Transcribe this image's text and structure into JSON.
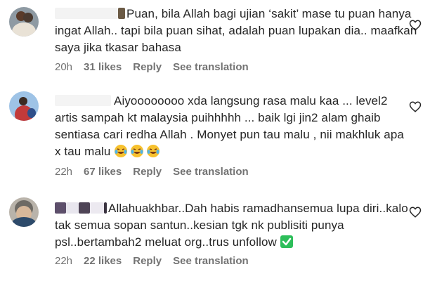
{
  "comments": [
    {
      "text": "Puan, bila Allah bagi ujian ‘sakit’ mase tu puan hanya ingat Allah.. tapi bila puan sihat, adalah puan lupakan dia.. maafkan saya jika tkasar bahasa",
      "time": "20h",
      "likes": "31 likes",
      "reply": "Reply",
      "translate": "See translation"
    },
    {
      "text": "Aiyoooooooo xda langsung rasa malu kaa ... level2 artis sampah kt malaysia puihhhhh ... baik lgi jin2 alam ghaib sentiasa cari redha Allah . Monyet pun tau malu , nii makhluk apa x tau malu",
      "emojis": [
        "laughing-crying",
        "laughing-crying",
        "laughing-crying"
      ],
      "time": "22h",
      "likes": "67 likes",
      "reply": "Reply",
      "translate": "See translation"
    },
    {
      "text": "Allahuakhbar..Dah habis ramadhansemua lupa diri..kalo tak semua sopan santun..kesian tgk nk publisiti punya psl..bertambah2 meluat org..trus unfollow",
      "emoji_end": "check-mark-button",
      "time": "22h",
      "likes": "22 likes",
      "reply": "Reply",
      "translate": "See translation"
    }
  ],
  "colors": {
    "text": "#262626",
    "meta": "#737373",
    "check": "#2dbe5a"
  }
}
